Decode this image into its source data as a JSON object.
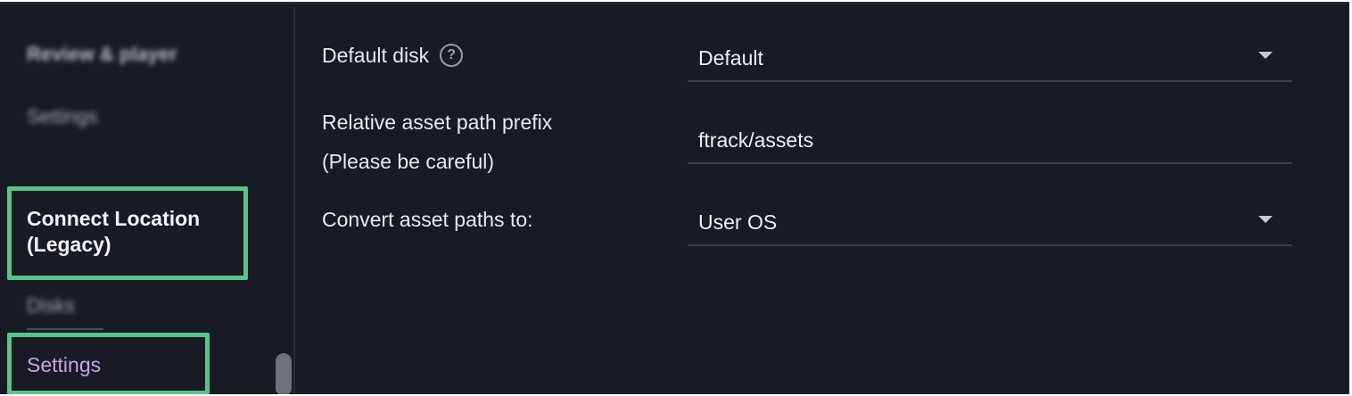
{
  "sidebar": {
    "items": [
      {
        "label": "Review & player"
      },
      {
        "label": "Settings"
      }
    ],
    "section": {
      "label": "Connect Location (Legacy)"
    },
    "sub_items": [
      {
        "label": "Disks"
      },
      {
        "label": "Settings"
      }
    ]
  },
  "form": {
    "default_disk": {
      "label": "Default disk",
      "help_icon": "question-circle-icon",
      "value": "Default"
    },
    "relative_prefix": {
      "label_line1": "Relative asset path prefix",
      "label_line2": "(Please be careful)",
      "value": "ftrack/assets"
    },
    "convert_paths": {
      "label": "Convert asset paths to:",
      "value": "User OS"
    }
  },
  "colors": {
    "background": "#181b24",
    "highlight": "#57c48b",
    "active_item": "#c8a3e8",
    "text": "#e8e9ec"
  }
}
